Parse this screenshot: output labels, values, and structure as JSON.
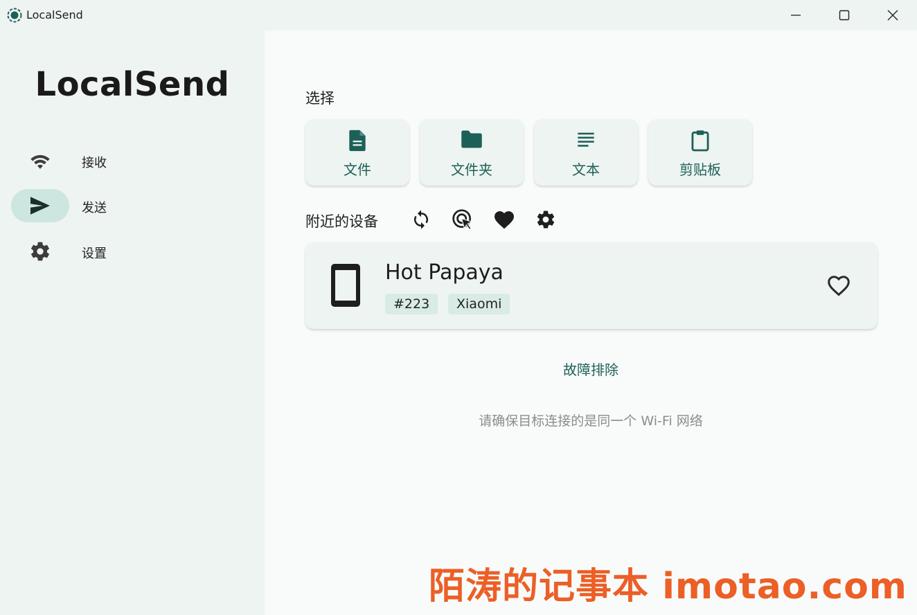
{
  "window": {
    "title": "LocalSend",
    "controls": {
      "minimize": "minimize-icon",
      "maximize": "maximize-icon",
      "close": "close-icon"
    }
  },
  "sidebar": {
    "brand": "LocalSend",
    "items": [
      {
        "label": "接收",
        "icon": "wifi-icon",
        "active": false
      },
      {
        "label": "发送",
        "icon": "send-icon",
        "active": true
      },
      {
        "label": "设置",
        "icon": "gear-icon",
        "active": false
      }
    ]
  },
  "main": {
    "select_title": "选择",
    "select_buttons": [
      {
        "label": "文件",
        "icon": "file-icon"
      },
      {
        "label": "文件夹",
        "icon": "folder-icon"
      },
      {
        "label": "文本",
        "icon": "text-icon"
      },
      {
        "label": "剪贴板",
        "icon": "clipboard-icon"
      }
    ],
    "devices_title": "附近的设备",
    "device_tools": [
      "refresh-icon",
      "scan-icon",
      "favorite-icon",
      "gear-icon"
    ],
    "devices": [
      {
        "name": "Hot Papaya",
        "id_tag": "#223",
        "vendor_tag": "Xiaomi",
        "icon": "phone-icon"
      }
    ],
    "troubleshoot_label": "故障排除",
    "hint": "请确保目标连接的是同一个 Wi-Fi 网络"
  },
  "watermark": "陌涛的记事本 imotao.com",
  "colors": {
    "accent": "#1d6058",
    "sidebar_bg": "#eef4f1",
    "content_bg": "#f8fbfa",
    "active_pill": "#cde6df",
    "watermark": "#ec5f26"
  }
}
